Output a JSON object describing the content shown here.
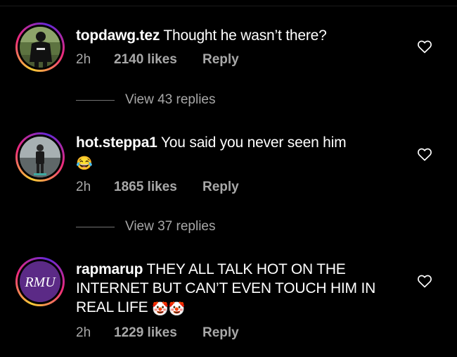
{
  "comments": [
    {
      "username": "topdawg.tez",
      "text": "Thought he wasn’t there?",
      "time": "2h",
      "likes": "2140 likes",
      "reply_label": "Reply",
      "avatar_icon": "person-in-black-hoodie-photo",
      "view_replies": "View 43 replies"
    },
    {
      "username": "hot.steppa1",
      "text": "You said you never seen him",
      "emoji": "😂",
      "time": "2h",
      "likes": "1865 likes",
      "reply_label": "Reply",
      "avatar_icon": "person-standing-photo",
      "view_replies": "View 37 replies"
    },
    {
      "username": "rapmarup",
      "text": "THEY ALL TALK HOT ON THE INTERNET BUT CAN’T EVEN TOUCH HIM IN REAL LIFE",
      "emoji": "🤡🤡",
      "time": "2h",
      "likes": "1229 likes",
      "reply_label": "Reply",
      "avatar_logo_text": "RMU",
      "avatar_color": "#5b2a86"
    }
  ],
  "colors": {
    "background": "#000000",
    "text": "#ffffff",
    "muted": "#a8a8a8"
  }
}
